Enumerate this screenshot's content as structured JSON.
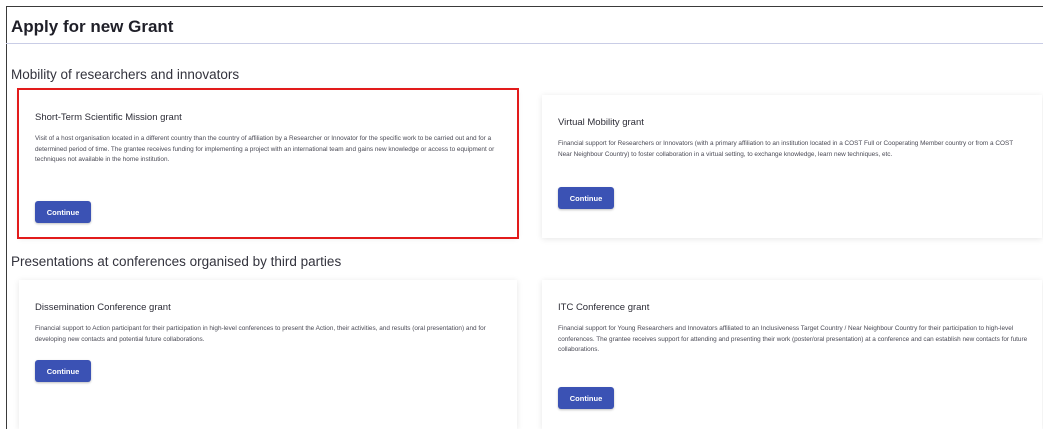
{
  "page": {
    "title": "Apply for new Grant"
  },
  "sections": [
    {
      "title": "Mobility of researchers and innovators",
      "cards": [
        {
          "title": "Short-Term Scientific Mission grant",
          "description": "Visit of a host organisation located in a different country than the country of affiliation by a Researcher or Innovator for the specific work to be carried out and for a determined period of time. The grantee receives funding for implementing a project with an international team and gains new knowledge or access to equipment or techniques not available in the home institution.",
          "button_label": "Continue"
        },
        {
          "title": "Virtual Mobility grant",
          "description": "Financial support for Researchers or Innovators (with a primary affiliation to an institution located in a COST Full or Cooperating Member country or from a COST Near Neighbour Country) to foster collaboration in a virtual setting, to exchange knowledge, learn new techniques, etc.",
          "button_label": "Continue"
        }
      ]
    },
    {
      "title": "Presentations at conferences organised by third parties",
      "cards": [
        {
          "title": "Dissemination Conference grant",
          "description": "Financial support to Action participant for their participation in high-level conferences to present the Action, their activities, and results (oral presentation) and for developing new contacts and potential future collaborations.",
          "button_label": "Continue"
        },
        {
          "title": "ITC Conference grant",
          "description": "Financial support for Young Researchers and Innovators affiliated to an Inclusiveness Target Country / Near Neighbour Country for their participation to high-level conferences. The grantee receives support for attending and presenting their work (poster/oral presentation) at a conference and can establish new contacts for future collaborations.",
          "button_label": "Continue"
        }
      ]
    }
  ],
  "colors": {
    "button": "#3b52b4",
    "highlight": "#e21b1b",
    "title_rule": "#c9cde6"
  }
}
